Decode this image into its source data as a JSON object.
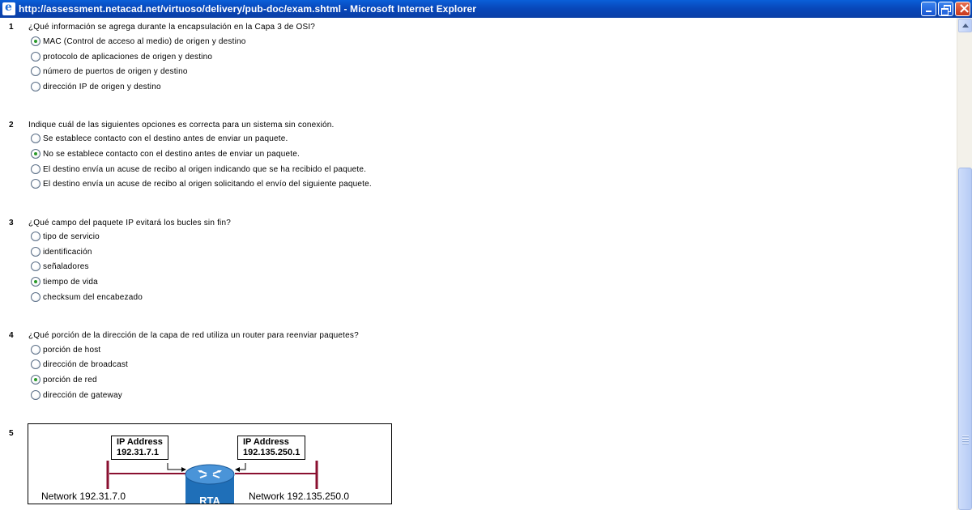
{
  "window": {
    "title": "http://assessment.netacad.net/virtuoso/delivery/pub-doc/exam.shtml - Microsoft Internet Explorer",
    "icon": "ie-icon"
  },
  "questions": [
    {
      "number": "1",
      "text": "¿Qué información se agrega durante la encapsulación en la Capa 3 de OSI?",
      "options": [
        {
          "label": "MAC (Control de acceso al medio) de origen y destino",
          "checked": true
        },
        {
          "label": "protocolo de aplicaciones de origen y destino",
          "checked": false
        },
        {
          "label": "número de puertos de origen y destino",
          "checked": false
        },
        {
          "label": "dirección IP de origen y destino",
          "checked": false
        }
      ]
    },
    {
      "number": "2",
      "text": "Indique cuál de las siguientes opciones es correcta para un sistema sin conexión.",
      "options": [
        {
          "label": "Se establece contacto con el destino antes de enviar un paquete.",
          "checked": false
        },
        {
          "label": "No se establece contacto con el destino antes de enviar un paquete.",
          "checked": true
        },
        {
          "label": "El destino envía un acuse de recibo al origen indicando que se ha recibido el paquete.",
          "checked": false
        },
        {
          "label": "El destino envía un acuse de recibo al origen solicitando el envío del siguiente paquete.",
          "checked": false
        }
      ]
    },
    {
      "number": "3",
      "text": "¿Qué campo del paquete IP evitará los bucles sin fin?",
      "options": [
        {
          "label": "tipo de servicio",
          "checked": false
        },
        {
          "label": "identificación",
          "checked": false
        },
        {
          "label": "señaladores",
          "checked": false
        },
        {
          "label": "tiempo de vida",
          "checked": true
        },
        {
          "label": "checksum del encabezado",
          "checked": false
        }
      ]
    },
    {
      "number": "4",
      "text": "¿Qué porción de la dirección de la capa de red utiliza un router para reenviar paquetes?",
      "options": [
        {
          "label": "porción de host",
          "checked": false
        },
        {
          "label": "dirección de broadcast",
          "checked": false
        },
        {
          "label": "porción de red",
          "checked": true
        },
        {
          "label": "dirección de gateway",
          "checked": false
        }
      ]
    },
    {
      "number": "5",
      "text": "",
      "options": []
    }
  ],
  "diagram": {
    "left_box": {
      "title": "IP Address",
      "value": "192.31.7.1"
    },
    "right_box": {
      "title": "IP Address",
      "value": "192.135.250.1"
    },
    "router_label": "RTA",
    "left_network": "Network 192.31.7.0",
    "right_network": "Network 192.135.250.0",
    "colors": {
      "router": "#1f6fb8",
      "segment": "#8a1030"
    }
  }
}
